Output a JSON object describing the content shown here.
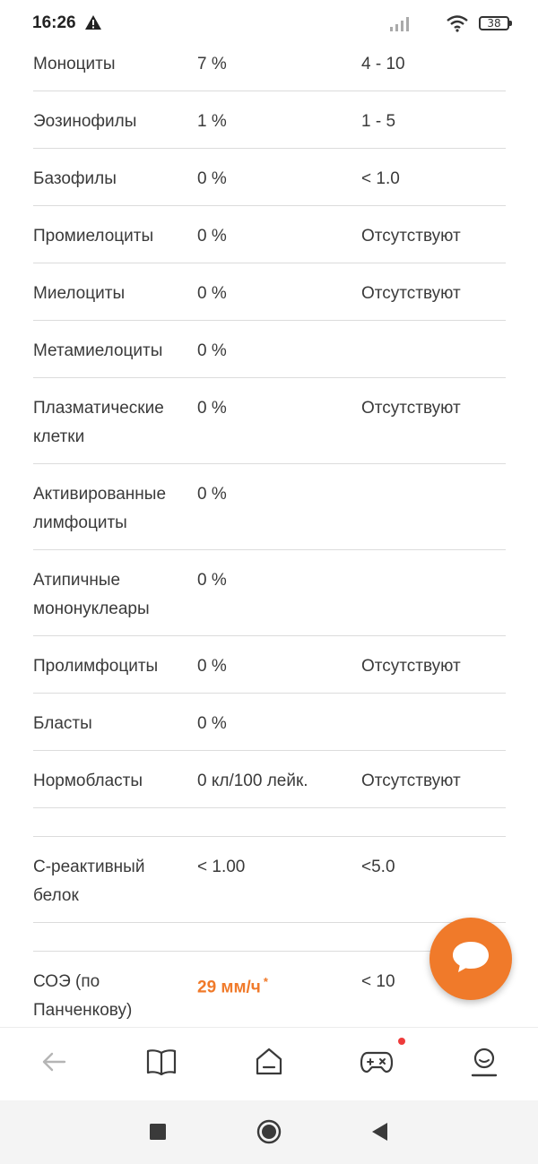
{
  "status_bar": {
    "time": "16:26",
    "battery": "38"
  },
  "results": [
    {
      "name": "Моноциты",
      "value": "7 %",
      "ref": "4 - 10"
    },
    {
      "name": "Эозинофилы",
      "value": "1 %",
      "ref": "1 - 5"
    },
    {
      "name": "Базофилы",
      "value": "0 %",
      "ref": "< 1.0"
    },
    {
      "name": "Промиелоциты",
      "value": "0 %",
      "ref": "Отсутствуют"
    },
    {
      "name": "Миелоциты",
      "value": "0 %",
      "ref": "Отсутствуют"
    },
    {
      "name": "Метамиелоциты",
      "value": "0 %",
      "ref": ""
    },
    {
      "name": "Плазматические клетки",
      "value": "0 %",
      "ref": "Отсутствуют"
    },
    {
      "name": "Активированные лимфоциты",
      "value": "0 %",
      "ref": ""
    },
    {
      "name": "Атипичные мононуклеары",
      "value": "0 %",
      "ref": ""
    },
    {
      "name": "Пролимфоциты",
      "value": "0 %",
      "ref": "Отсутствуют"
    },
    {
      "name": "Бласты",
      "value": "0 %",
      "ref": ""
    },
    {
      "name": "Нормобласты",
      "value": "0 кл/100 лейк.",
      "ref": "Отсутствуют"
    },
    {
      "name": "С-реактивный белок",
      "value": "< 1.00",
      "ref": "<5.0"
    },
    {
      "name": "СОЭ (по Панченкову)",
      "value": "29 мм/ч",
      "value_mark": "*",
      "ref": "< 10"
    }
  ],
  "colors": {
    "accent": "#f07a2a",
    "divider": "#dcdcdc",
    "notification_dot": "#ee3b3b"
  },
  "bottom_nav": {
    "items": [
      "back-arrow-icon",
      "book-icon",
      "home-icon",
      "gamepad-icon",
      "profile-icon"
    ]
  },
  "system_nav": {
    "items": [
      "square-icon",
      "circle-icon",
      "triangle-back-icon"
    ]
  }
}
